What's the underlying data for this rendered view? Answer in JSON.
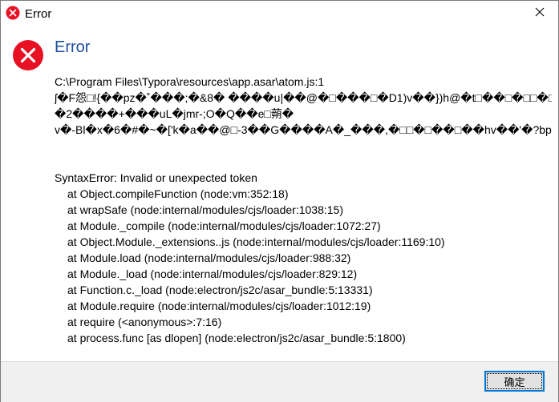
{
  "window": {
    "title": "Error",
    "title_icon": "error-icon",
    "close_icon": "close-icon"
  },
  "dialog": {
    "heading": "Error",
    "icon": "error-icon",
    "path_line": "C:\\Program Files\\Typora\\resources\\app.asar\\atom.js:1",
    "garbled_lines": [
      "ʃ�F怨□!{��pz�˚���;�&8� ����u|��@�□���□�D1)v��})h@�t□��□�□□�□Z�_號�",
      "�2����+���uL�jmr-;O�Q��e□蒴�",
      "v�-Bl�x�6�#�~�['k�a��@□-3��G����A�_���,�□□�□��□��hv��'�?bp�□j�□Pj��±�"
    ],
    "error_line": "SyntaxError: Invalid or unexpected token",
    "stack": [
      "at Object.compileFunction (node:vm:352:18)",
      "at wrapSafe (node:internal/modules/cjs/loader:1038:15)",
      "at Module._compile (node:internal/modules/cjs/loader:1072:27)",
      "at Object.Module._extensions..js (node:internal/modules/cjs/loader:1169:10)",
      "at Module.load (node:internal/modules/cjs/loader:988:32)",
      "at Module._load (node:internal/modules/cjs/loader:829:12)",
      "at Function.c._load (node:electron/js2c/asar_bundle:5:13331)",
      "at Module.require (node:internal/modules/cjs/loader:1012:19)",
      "at require (<anonymous>:7:16)",
      "at process.func [as dlopen] (node:electron/js2c/asar_bundle:5:1800)"
    ]
  },
  "footer": {
    "ok_label": "确定"
  },
  "colors": {
    "error_red": "#e81123",
    "heading_blue": "#1f4e9c",
    "focus_blue": "#0078d7"
  }
}
